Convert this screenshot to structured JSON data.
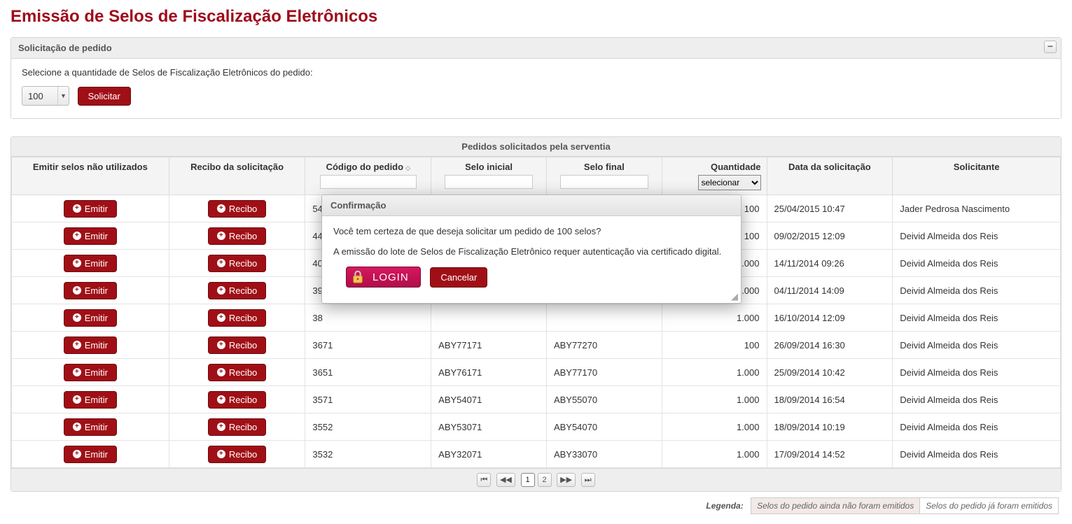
{
  "page": {
    "title": "Emissão de Selos de Fiscalização Eletrônicos"
  },
  "request_panel": {
    "header": "Solicitação de pedido",
    "instruction": "Selecione a quantidade de Selos de Fiscalização Eletrônicos do pedido:",
    "quantity_value": "100",
    "submit_label": "Solicitar"
  },
  "table": {
    "caption": "Pedidos solicitados pela serventia",
    "columns": {
      "emitir": "Emitir selos não utilizados",
      "recibo": "Recibo da solicitação",
      "codigo": "Código do pedido",
      "selo_inicial": "Selo inicial",
      "selo_final": "Selo final",
      "quantidade": "Quantidade",
      "quantidade_select": "selecionar",
      "data": "Data da solicitação",
      "solicitante": "Solicitante"
    },
    "emitir_label": "Emitir",
    "recibo_label": "Recibo",
    "rows": [
      {
        "codigo": "54",
        "selo_inicial": "",
        "selo_final": "",
        "quantidade": "100",
        "data": "25/04/2015 10:47",
        "solicitante": "Jader Pedrosa Nascimento"
      },
      {
        "codigo": "44",
        "selo_inicial": "",
        "selo_final": "",
        "quantidade": "100",
        "data": "09/02/2015 12:09",
        "solicitante": "Deivid Almeida dos Reis"
      },
      {
        "codigo": "40",
        "selo_inicial": "",
        "selo_final": "",
        "quantidade": "1.000",
        "data": "14/11/2014 09:26",
        "solicitante": "Deivid Almeida dos Reis"
      },
      {
        "codigo": "39",
        "selo_inicial": "",
        "selo_final": "",
        "quantidade": "10.000",
        "data": "04/11/2014 14:09",
        "solicitante": "Deivid Almeida dos Reis"
      },
      {
        "codigo": "38",
        "selo_inicial": "",
        "selo_final": "",
        "quantidade": "1.000",
        "data": "16/10/2014 12:09",
        "solicitante": "Deivid Almeida dos Reis"
      },
      {
        "codigo": "3671",
        "selo_inicial": "ABY77171",
        "selo_final": "ABY77270",
        "quantidade": "100",
        "data": "26/09/2014 16:30",
        "solicitante": "Deivid Almeida dos Reis"
      },
      {
        "codigo": "3651",
        "selo_inicial": "ABY76171",
        "selo_final": "ABY77170",
        "quantidade": "1.000",
        "data": "25/09/2014 10:42",
        "solicitante": "Deivid Almeida dos Reis"
      },
      {
        "codigo": "3571",
        "selo_inicial": "ABY54071",
        "selo_final": "ABY55070",
        "quantidade": "1.000",
        "data": "18/09/2014 16:54",
        "solicitante": "Deivid Almeida dos Reis"
      },
      {
        "codigo": "3552",
        "selo_inicial": "ABY53071",
        "selo_final": "ABY54070",
        "quantidade": "1.000",
        "data": "18/09/2014 10:19",
        "solicitante": "Deivid Almeida dos Reis"
      },
      {
        "codigo": "3532",
        "selo_inicial": "ABY32071",
        "selo_final": "ABY33070",
        "quantidade": "1.000",
        "data": "17/09/2014 14:52",
        "solicitante": "Deivid Almeida dos Reis"
      }
    ],
    "pages": [
      "1",
      "2"
    ]
  },
  "legend": {
    "label": "Legenda:",
    "pending": "Selos do pedido ainda não foram emitidos",
    "done": "Selos do pedido já foram emitidos"
  },
  "dialog": {
    "title": "Confirmação",
    "line1": "Você tem certeza de que deseja solicitar um pedido de 100 selos?",
    "line2": "A emissão do lote de Selos de Fiscalização Eletrônico requer autenticação via certificado digital.",
    "login_label": "LOGIN",
    "cancel_label": "Cancelar"
  }
}
